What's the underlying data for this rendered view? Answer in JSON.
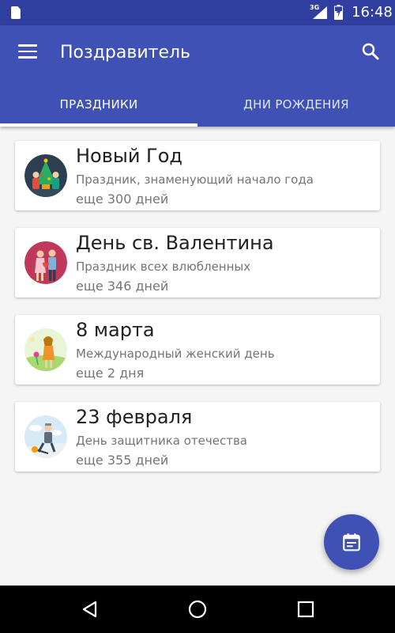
{
  "status_bar": {
    "network_label": "3G",
    "time": "16:48"
  },
  "app_bar": {
    "title": "Поздравитель",
    "menu_icon": "menu-icon",
    "search_icon": "search-icon"
  },
  "tabs": [
    {
      "label": "ПРАЗДНИКИ",
      "selected": true
    },
    {
      "label": "ДНИ РОЖДЕНИЯ",
      "selected": false
    }
  ],
  "holidays": [
    {
      "title": "Новый Год",
      "description": "Праздник, знаменующий начало года",
      "days_left": "еще 300 дней",
      "icon": "new-year-illustration"
    },
    {
      "title": "День св. Валентина",
      "description": "Праздник всех влюбленных",
      "days_left": "еще 346 дней",
      "icon": "valentine-illustration"
    },
    {
      "title": "8 марта",
      "description": "Международный женский день",
      "days_left": "еще 2 дня",
      "icon": "womens-day-illustration"
    },
    {
      "title": "23 февраля",
      "description": "День защитника отечества",
      "days_left": "еще 355 дней",
      "icon": "defender-day-illustration"
    }
  ],
  "fab": {
    "icon": "calendar-icon"
  },
  "nav_bar": {
    "icons": [
      "back-icon",
      "home-icon",
      "recents-icon"
    ]
  },
  "colors": {
    "primary": "#3f51b5",
    "primary_dark": "#303f9f",
    "background": "#f5f5f5"
  }
}
